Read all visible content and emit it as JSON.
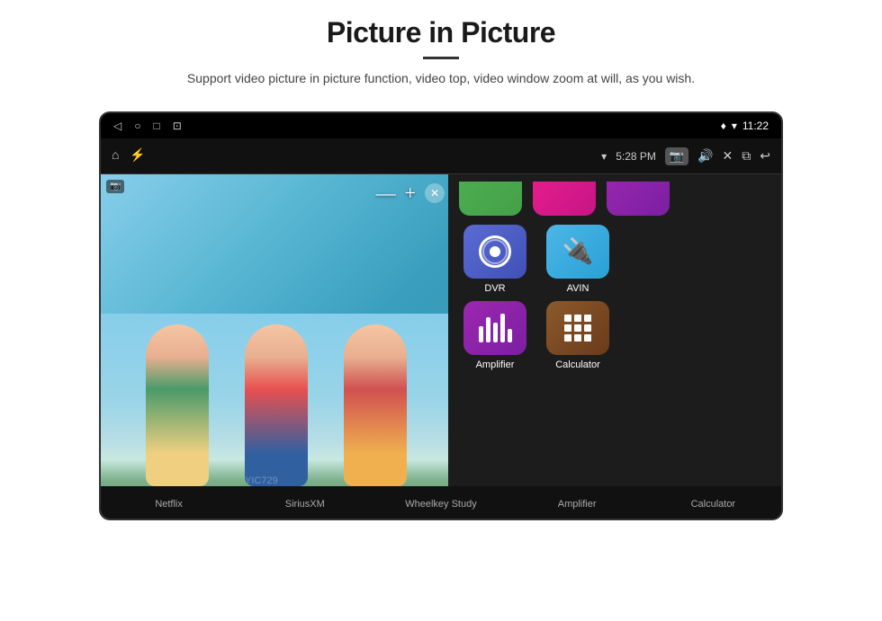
{
  "header": {
    "title": "Picture in Picture",
    "subtitle": "Support video picture in picture function, video top, video window zoom at will, as you wish."
  },
  "status_bar": {
    "time": "11:22",
    "nav_icons": [
      "◁",
      "○",
      "□",
      "⊡"
    ]
  },
  "toolbar": {
    "time": "5:28 PM",
    "camera_label": "📷"
  },
  "pip_controls": {
    "minus": "—",
    "plus": "+",
    "close": "✕"
  },
  "apps": {
    "top_partial": [
      {
        "label": "Netflix",
        "color_class": "netflix-partial"
      },
      {
        "label": "SiriusXM",
        "color_class": "siriusxm-partial"
      },
      {
        "label": "Wheelkey Study",
        "color_class": "wheelkey-partial"
      }
    ],
    "main_row1": [
      {
        "id": "dvr",
        "label": "DVR"
      },
      {
        "id": "avin",
        "label": "AVIN"
      }
    ],
    "main_row2": [
      {
        "id": "amplifier",
        "label": "Amplifier"
      },
      {
        "id": "calculator",
        "label": "Calculator"
      }
    ]
  },
  "bottom_labels": [
    "Netflix",
    "SiriusXM",
    "Wheelkey Study",
    "Amplifier",
    "Calculator"
  ],
  "watermark": "YIC729"
}
